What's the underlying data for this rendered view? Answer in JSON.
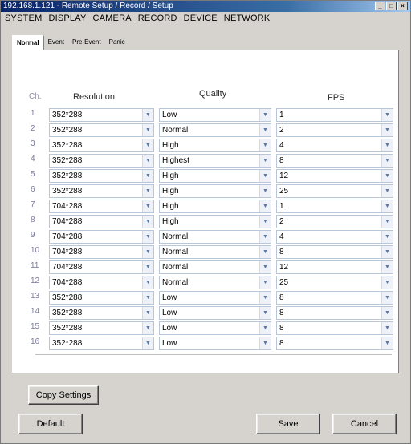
{
  "window": {
    "title": "192.168.1.121 - Remote Setup / Record / Setup"
  },
  "menu": [
    "SYSTEM",
    "DISPLAY",
    "CAMERA",
    "RECORD",
    "DEVICE",
    "NETWORK"
  ],
  "tabs": [
    {
      "label": "Normal",
      "active": true
    },
    {
      "label": "Event",
      "active": false
    },
    {
      "label": "Pre-Event",
      "active": false
    },
    {
      "label": "Panic",
      "active": false
    }
  ],
  "headers": {
    "ch": "Ch.",
    "resolution": "Resolution",
    "quality": "Quality",
    "fps": "FPS"
  },
  "rows": [
    {
      "ch": "1",
      "resolution": "352*288",
      "quality": "Low",
      "fps": "1"
    },
    {
      "ch": "2",
      "resolution": "352*288",
      "quality": "Normal",
      "fps": "2"
    },
    {
      "ch": "3",
      "resolution": "352*288",
      "quality": "High",
      "fps": "4"
    },
    {
      "ch": "4",
      "resolution": "352*288",
      "quality": "Highest",
      "fps": "8"
    },
    {
      "ch": "5",
      "resolution": "352*288",
      "quality": "High",
      "fps": "12"
    },
    {
      "ch": "6",
      "resolution": "352*288",
      "quality": "High",
      "fps": "25"
    },
    {
      "ch": "7",
      "resolution": "704*288",
      "quality": "High",
      "fps": "1"
    },
    {
      "ch": "8",
      "resolution": "704*288",
      "quality": "High",
      "fps": "2"
    },
    {
      "ch": "9",
      "resolution": "704*288",
      "quality": "Normal",
      "fps": "4"
    },
    {
      "ch": "10",
      "resolution": "704*288",
      "quality": "Normal",
      "fps": "8"
    },
    {
      "ch": "11",
      "resolution": "704*288",
      "quality": "Normal",
      "fps": "12"
    },
    {
      "ch": "12",
      "resolution": "704*288",
      "quality": "Normal",
      "fps": "25"
    },
    {
      "ch": "13",
      "resolution": "352*288",
      "quality": "Low",
      "fps": "8"
    },
    {
      "ch": "14",
      "resolution": "352*288",
      "quality": "Low",
      "fps": "8"
    },
    {
      "ch": "15",
      "resolution": "352*288",
      "quality": "Low",
      "fps": "8"
    },
    {
      "ch": "16",
      "resolution": "352*288",
      "quality": "Low",
      "fps": "8"
    }
  ],
  "buttons": {
    "copy": "Copy Settings",
    "default": "Default",
    "save": "Save",
    "cancel": "Cancel"
  },
  "icons": {
    "minimize": "minimize-icon",
    "maximize": "maximize-icon",
    "close": "close-icon",
    "dropdown": "chevron-down-icon"
  }
}
